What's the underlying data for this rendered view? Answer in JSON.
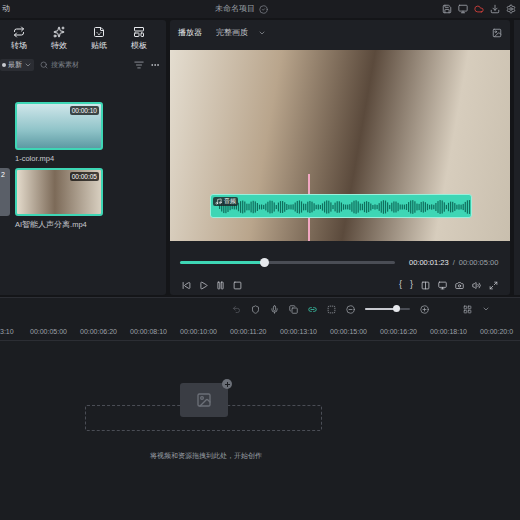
{
  "window": {
    "title_prefix": "动",
    "title": "未命名项目"
  },
  "media_tabs": [
    {
      "label": "转场"
    },
    {
      "label": "特效"
    },
    {
      "label": "贴纸"
    },
    {
      "label": "模板"
    }
  ],
  "sort": {
    "label": "最新"
  },
  "search": {
    "placeholder": "搜索素材"
  },
  "partial_card": {
    "badge": "2"
  },
  "media": [
    {
      "name": "1-color.mp4",
      "duration": "00:00:10",
      "selected": true
    },
    {
      "name": "AI智能人声分离.mp4",
      "duration": "00:00:05",
      "selected": true
    }
  ],
  "player": {
    "label": "播放器",
    "quality": "完整画质",
    "clip_label": "音频",
    "current_time": "00:00:01:23",
    "separator": "/",
    "total_time": "00:00:05:00",
    "level": 0.39,
    "mark_in": "{",
    "mark_out": "}"
  },
  "timeline": {
    "zoom_level": 0.69,
    "ruler": [
      "3:10",
      "00:00:05:00",
      "00:00:06:20",
      "00:00:08:10",
      "00:00:10:00",
      "00:00:11:20",
      "00:00:13:10",
      "00:00:15:00",
      "00:00:16:20",
      "00:00:18:10",
      "00:00:20:0"
    ],
    "drop_hint": "将视频和资源拖拽到此处，开始创作"
  }
}
